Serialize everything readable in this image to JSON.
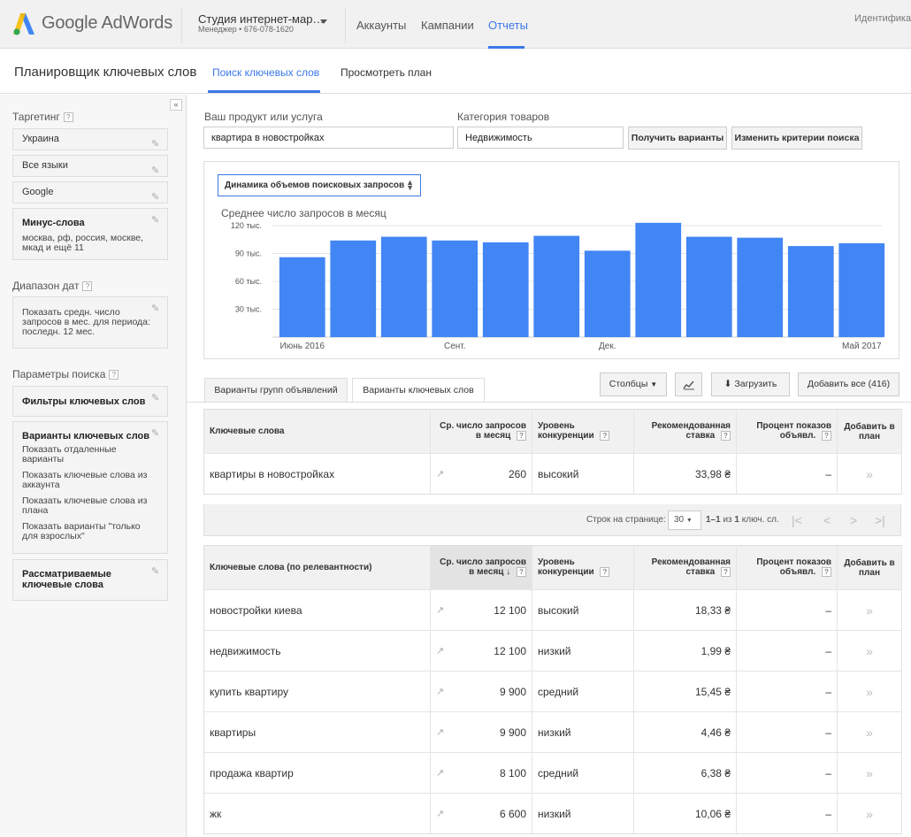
{
  "header": {
    "logo_text": "Google AdWords",
    "account_name": "Студия интернет-мар…",
    "account_sub": "Менеджер • 676-078-1620",
    "nav": [
      "Аккаунты",
      "Кампании",
      "Отчеты"
    ],
    "right_text": "Идентифика"
  },
  "subheader": {
    "title": "Планировщик ключевых слов",
    "tabs": [
      "Поиск ключевых слов",
      "Просмотреть план"
    ]
  },
  "sidebar": {
    "targeting_label": "Таргетинг",
    "location": "Украина",
    "language": "Все языки",
    "network": "Google",
    "negative_title": "Минус-слова",
    "negative_values": "москва, рф, россия, москве, мкад и ещё 11",
    "daterange_label": "Диапазон дат",
    "daterange_value": "Показать средн. число запросов в мес. для периода: последн. 12 мес.",
    "params_label": "Параметры поиска",
    "filters_title": "Фильтры ключевых слов",
    "options_title": "Варианты ключевых слов",
    "options": [
      "Показать отдаленные варианты",
      "Показать ключевые слова из аккаунта",
      "Показать ключевые слова из плана",
      "Показать варианты \"только для взрослых\""
    ],
    "considered_title": "Рассматриваемые ключевые слова"
  },
  "search": {
    "product_label": "Ваш продукт или услуга",
    "product_value": "квартира в новостройках",
    "category_label": "Категория товаров",
    "category_value": "Недвижимость",
    "get_ideas": "Получить варианты",
    "modify": "Изменить критерии поиска"
  },
  "chart_select": "Динамика объемов поисковых запросов",
  "chart_data": {
    "type": "bar",
    "title": "Среднее число запросов в месяц",
    "categories": [
      "Июнь 2016",
      "",
      "",
      "Сент.",
      "",
      "",
      "Дек.",
      "",
      "",
      "",
      "",
      "Май 2017"
    ],
    "values": [
      86000,
      104000,
      108000,
      104000,
      102000,
      109000,
      93000,
      123000,
      108000,
      107000,
      98000,
      101000
    ],
    "ylim": [
      0,
      120000
    ],
    "yticks": [
      {
        "v": 30000,
        "label": "30 тыс."
      },
      {
        "v": 60000,
        "label": "60 тыс."
      },
      {
        "v": 90000,
        "label": "90 тыс."
      },
      {
        "v": 120000,
        "label": "120 тыс."
      }
    ],
    "color": "#4285f4",
    "grid": true
  },
  "tabs": [
    "Варианты групп объявлений",
    "Варианты ключевых слов"
  ],
  "toolbar": {
    "columns": "Столбцы",
    "download": "Загрузить",
    "add_all": "Добавить все (416)"
  },
  "table1": {
    "headers": [
      "Ключевые слова",
      "Ср. число запросов в месяц",
      "Уровень конкуренции",
      "Рекомендованная ставка",
      "Процент показов объявл.",
      "Добавить в план"
    ],
    "rows": [
      [
        "квартиры в новостройках",
        "260",
        "высокий",
        "33,98 ₴",
        "–"
      ]
    ]
  },
  "pager": {
    "label": "Строк на странице:",
    "per_page": "30",
    "range_a": "1–1",
    "range_mid": " из ",
    "range_b": "1",
    "range_tail": " ключ. сл."
  },
  "table2": {
    "headers": [
      "Ключевые слова (по релевантности)",
      "Ср. число запросов в месяц",
      "Уровень конкуренции",
      "Рекомендованная ставка",
      "Процент показов объявл.",
      "Добавить в план"
    ],
    "rows": [
      [
        "новостройки киева",
        "12 100",
        "высокий",
        "18,33 ₴",
        "–"
      ],
      [
        "недвижимость",
        "12 100",
        "низкий",
        "1,99 ₴",
        "–"
      ],
      [
        "купить квартиру",
        "9 900",
        "средний",
        "15,45 ₴",
        "–"
      ],
      [
        "квартиры",
        "9 900",
        "низкий",
        "4,46 ₴",
        "–"
      ],
      [
        "продажа квартир",
        "8 100",
        "средний",
        "6,38 ₴",
        "–"
      ],
      [
        "жк",
        "6 600",
        "низкий",
        "10,06 ₴",
        "–"
      ]
    ]
  }
}
